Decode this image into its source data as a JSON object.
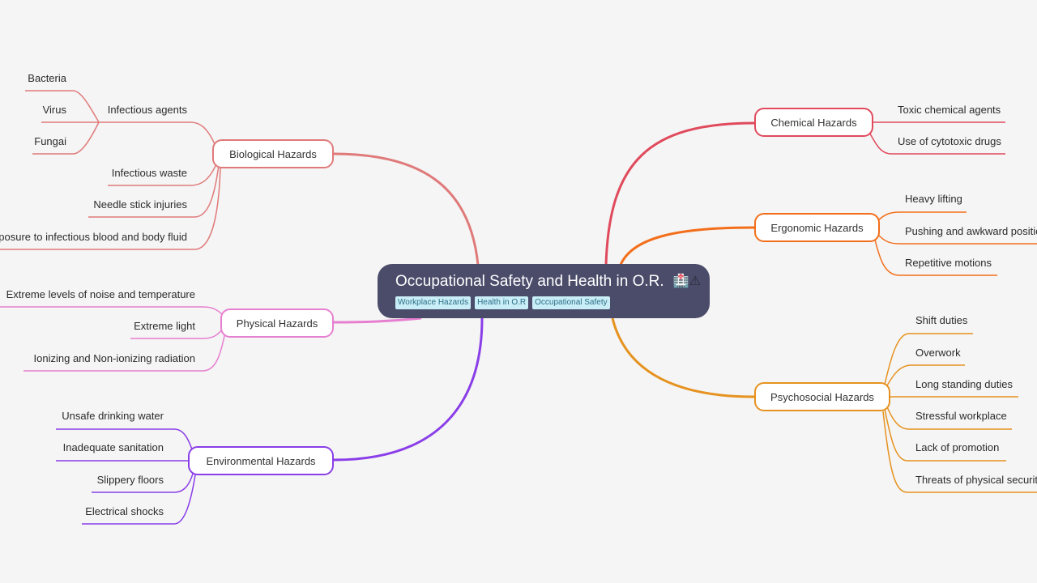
{
  "root": {
    "title": "Occupational Safety and Health in O.R.",
    "icons": [
      "hospital-icon",
      "warning-icon"
    ],
    "icon_glyphs": "🏥⚠",
    "tags": [
      "Workplace Hazards",
      "Health in O.R",
      "Occupational Safety"
    ]
  },
  "colors": {
    "background": "#f5f5f5",
    "root_bg": "#4a4c6a",
    "tag_bg": "#c9eef7",
    "tag_text": "#2b6f87",
    "biological": "#e07a7a",
    "physical": "#e77fd0",
    "environmental": "#8a3ee8",
    "chemical": "#e04a5c",
    "ergonomic": "#f36e1a",
    "psychosocial": "#e6921f"
  },
  "branches": {
    "biological": {
      "label": "Biological Hazards",
      "children": [
        {
          "label": "Infectious agents",
          "children": [
            "Bacteria",
            "Virus",
            "Fungai"
          ]
        },
        {
          "label": "Infectious waste"
        },
        {
          "label": "Needle stick injuries"
        },
        {
          "label": "Exposure to infectious blood and body fluid"
        }
      ]
    },
    "physical": {
      "label": "Physical Hazards",
      "children": [
        "Extreme levels of noise and temperature",
        "Extreme light",
        "Ionizing and Non-ionizing radiation"
      ]
    },
    "environmental": {
      "label": "Environmental Hazards",
      "children": [
        "Unsafe drinking water",
        "Inadequate sanitation",
        "Slippery floors",
        "Electrical shocks"
      ]
    },
    "chemical": {
      "label": "Chemical Hazards",
      "children": [
        "Toxic chemical agents",
        "Use of cytotoxic drugs"
      ]
    },
    "ergonomic": {
      "label": "Ergonomic Hazards",
      "children": [
        "Heavy lifting",
        "Pushing and awkward positions",
        "Repetitive motions"
      ]
    },
    "psychosocial": {
      "label": "Psychosocial Hazards",
      "children": [
        "Shift duties",
        "Overwork",
        "Long standing duties",
        "Stressful workplace",
        "Lack of promotion",
        "Threats of physical security"
      ]
    }
  }
}
